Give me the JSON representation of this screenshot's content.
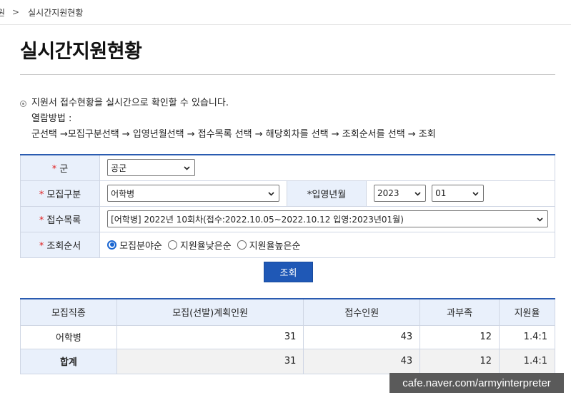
{
  "breadcrumb": {
    "prev": "원",
    "separator": ">",
    "current": "실시간지원현황"
  },
  "page_title": "실시간지원현황",
  "intro": {
    "line1": "지원서 접수현황을 실시간으로 확인할 수 있습니다.",
    "line2": "열람방법 :",
    "line3": "군선택 →모집구분선택 → 입영년월선택 → 접수목록 선택 → 해당회차를 선택 → 조회순서를 선택 → 조회"
  },
  "form": {
    "required_mark": "*",
    "branch": {
      "label": "군",
      "value": "공군"
    },
    "recruit_type": {
      "label": "모집구분",
      "value": "어학병"
    },
    "enlist_month": {
      "label": "*입영년월",
      "year": "2023",
      "month": "01"
    },
    "application_list": {
      "label": "접수목록",
      "value": "[어학병] 2022년 10회차(접수:2022.10.05~2022.10.12 입영:2023년01월)"
    },
    "sort_order": {
      "label": "조회순서",
      "options": [
        "모집분야순",
        "지원율낮은순",
        "지원율높은순"
      ],
      "selected": "모집분야순"
    }
  },
  "query_button": "조회",
  "results": {
    "headers": [
      "모집직종",
      "모집(선발)계획인원",
      "접수인원",
      "과부족",
      "지원율"
    ],
    "rows": [
      {
        "category": "어학병",
        "planned": "31",
        "applicants": "43",
        "difference": "12",
        "rate": "1.4:1"
      }
    ],
    "total": {
      "category": "합계",
      "planned": "31",
      "applicants": "43",
      "difference": "12",
      "rate": "1.4:1"
    }
  },
  "watermark": "cafe.naver.com/armyinterpreter"
}
